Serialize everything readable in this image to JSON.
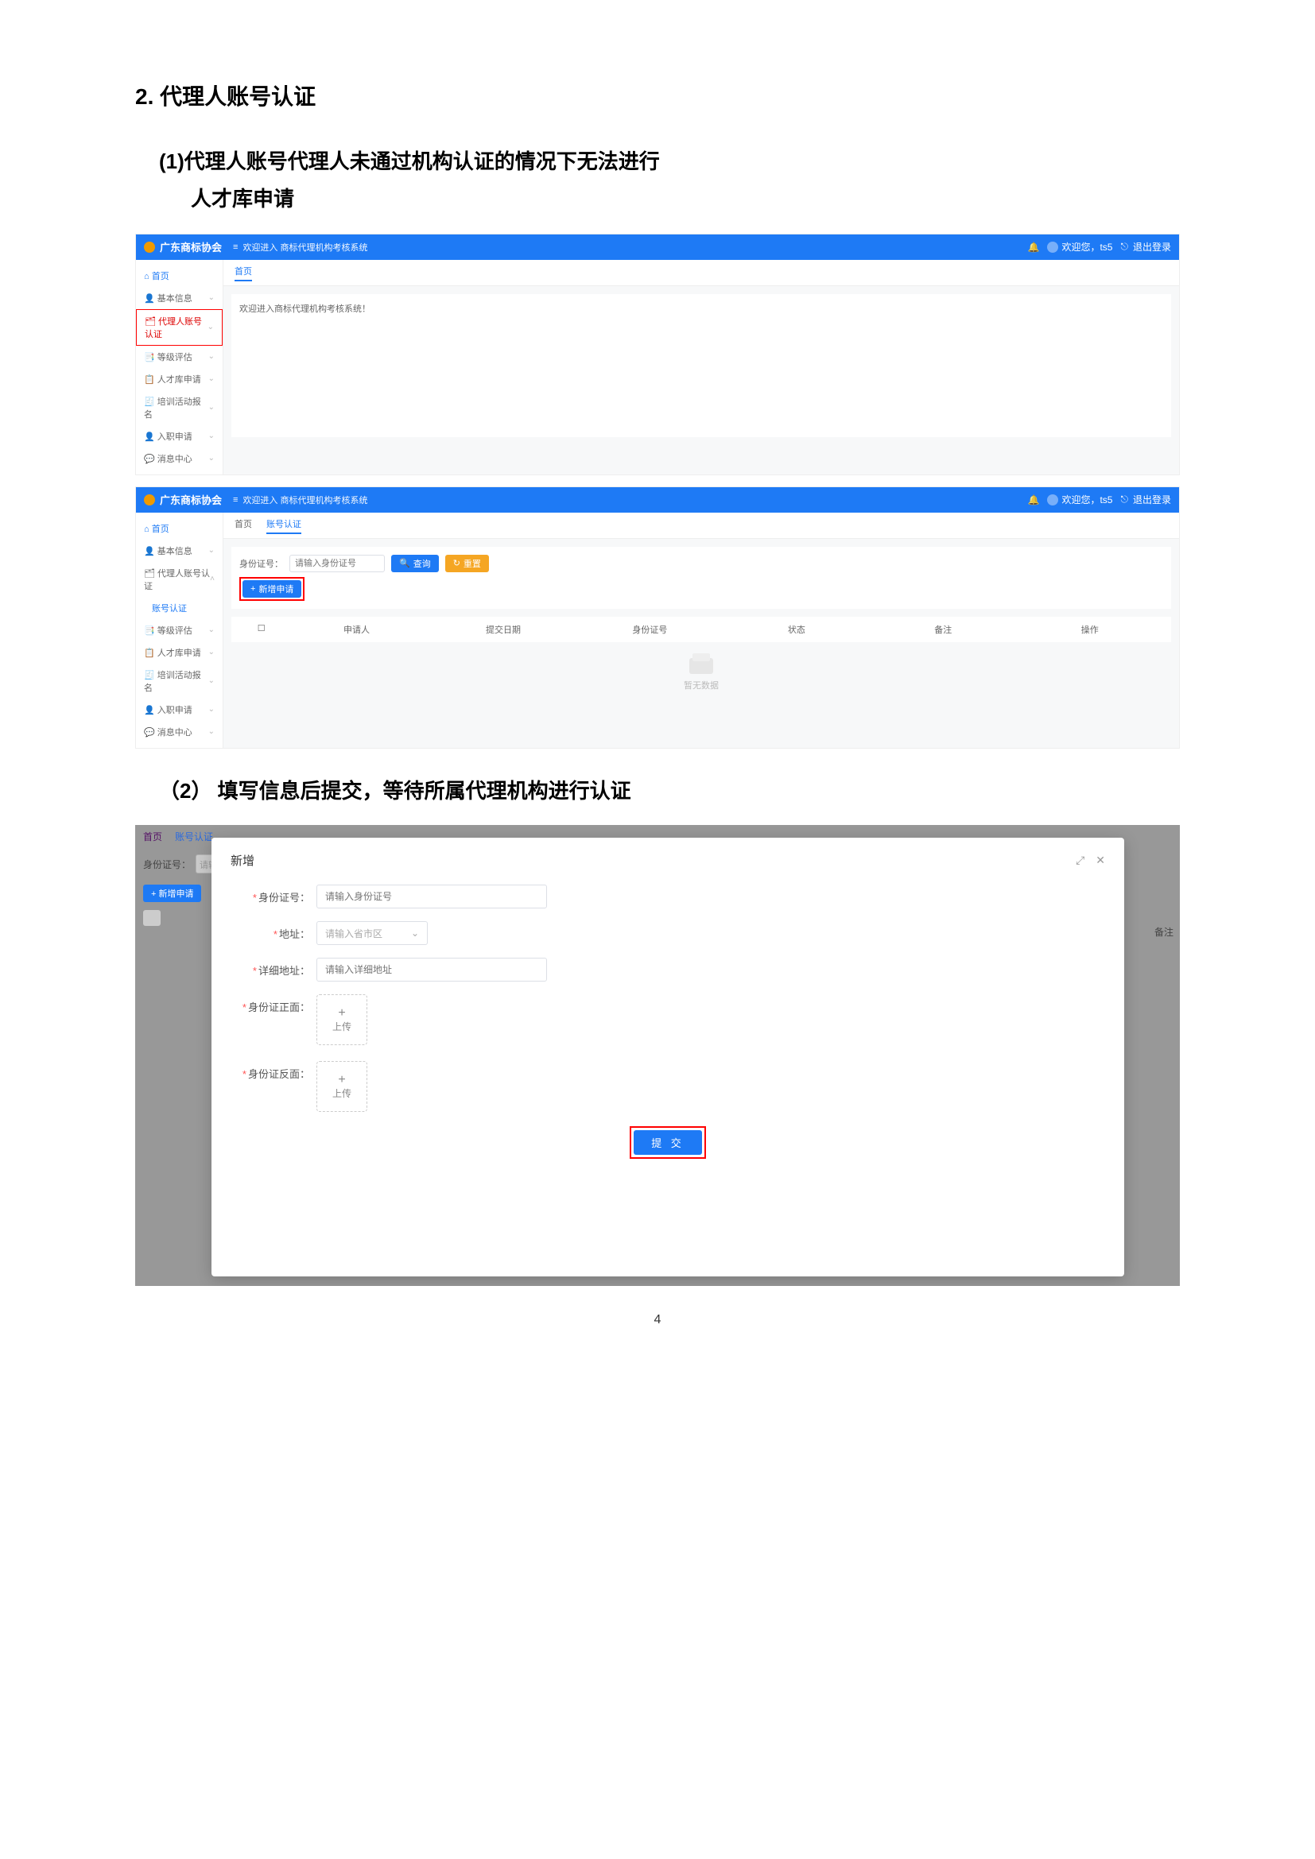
{
  "headings": {
    "main": "2. 代理人账号认证",
    "sub1_l1": "(1)代理人账号代理人未通过机构认证的情况下无法进行",
    "sub1_l2": "人才库申请",
    "sub2": "（2）  填写信息后提交，等待所属代理机构进行认证"
  },
  "app": {
    "brand": "广东商标协会",
    "subtitle_prefix": "≡",
    "subtitle": "欢迎进入 商标代理机构考核系统",
    "bell": "🔔",
    "welcome": "欢迎您，ts5",
    "logout_icon": "⎋",
    "logout": "退出登录"
  },
  "nav": {
    "home_icon": "⌂",
    "home": "首页",
    "basic_icon": "👤",
    "basic": "基本信息",
    "auth_icon": "🗂",
    "auth": "代理人账号认证",
    "auth_sub": "账号认证",
    "rank_icon": "📑",
    "rank": "等级评估",
    "talent_icon": "📋",
    "talent": "人才库申请",
    "train_icon": "🧾",
    "train": "培训活动报名",
    "entry_icon": "👤",
    "entry": "入职申请",
    "msg_icon": "💬",
    "msg": "消息中心",
    "chev_down": "⌄",
    "chev_up": "˄"
  },
  "fig1": {
    "tab_home": "首页",
    "welcome_msg": "欢迎进入商标代理机构考核系统！"
  },
  "fig2": {
    "tab_home": "首页",
    "tab_auth": "账号认证",
    "id_label": "身份证号：",
    "id_placeholder": "请输入身份证号",
    "search_icon": "🔍",
    "search": "查询",
    "reset_icon": "↻",
    "reset": "重置",
    "add_icon": "+",
    "add": "新增申请",
    "cols": {
      "chk": "",
      "applicant": "申请人",
      "date": "提交日期",
      "idno": "身份证号",
      "status": "状态",
      "remark": "备注",
      "op": "操作"
    },
    "empty": "暂无数据"
  },
  "fig3": {
    "bg_tabs": {
      "home": "首页",
      "auth": "账号认证"
    },
    "bg_id_label": "身份证号：",
    "bg_id_ph": "请输",
    "bg_add": "+  新增申请",
    "bg_remark": "备注",
    "dlg_title": "新增",
    "expand": "⤢",
    "close": "✕",
    "f_id": "身份证号：",
    "f_id_ph": "请输入身份证号",
    "f_addr": "地址：",
    "f_addr_ph": "请输入省市区",
    "f_addr_chev": "⌄",
    "f_addr2": "详细地址：",
    "f_addr2_ph": "请输入详细地址",
    "f_front": "身份证正面：",
    "f_back": "身份证反面：",
    "upload": "上传",
    "upload_plus": "+",
    "submit": "提 交"
  },
  "page_number": "4"
}
